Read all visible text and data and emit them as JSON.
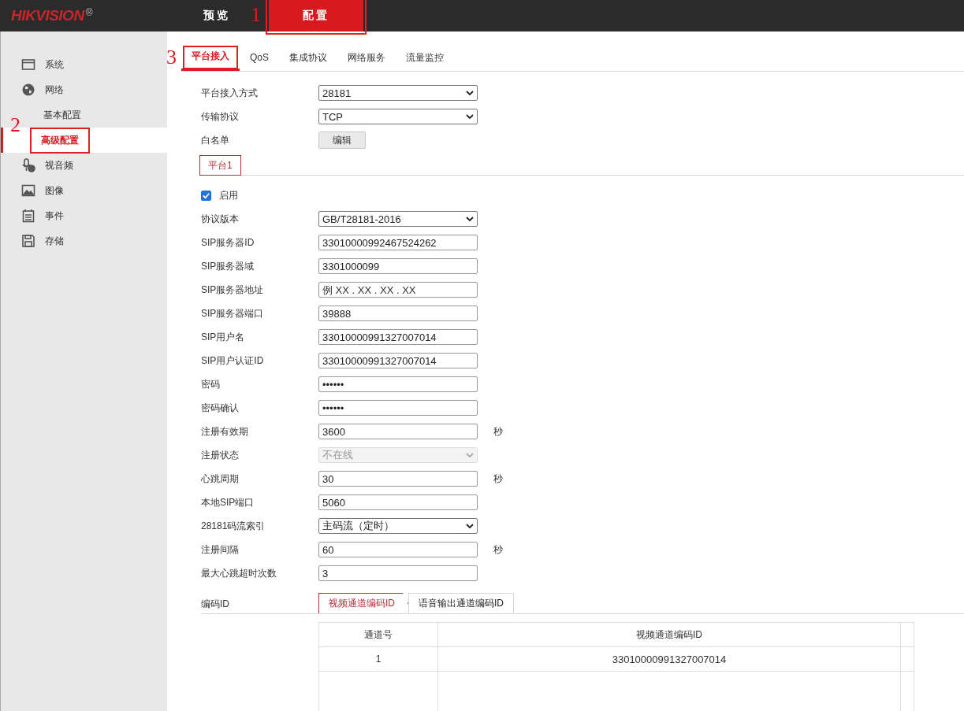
{
  "header": {
    "logo": "HIKVISION",
    "logo_mark": "®",
    "nav": [
      {
        "label": "预览",
        "selected": false
      },
      {
        "label": "配置",
        "selected": true,
        "callout": "1"
      }
    ]
  },
  "sidebar": {
    "items": [
      {
        "label": "系统"
      },
      {
        "label": "网络",
        "children": [
          {
            "label": "基本配置",
            "selected": false
          },
          {
            "label": "高级配置",
            "selected": true,
            "callout": "2"
          }
        ]
      },
      {
        "label": "视音频"
      },
      {
        "label": "图像"
      },
      {
        "label": "事件"
      },
      {
        "label": "存储"
      }
    ]
  },
  "subtabs": [
    {
      "label": "平台接入",
      "selected": true,
      "callout": "3"
    },
    {
      "label": "QoS",
      "selected": false
    },
    {
      "label": "集成协议",
      "selected": false
    },
    {
      "label": "网络服务",
      "selected": false
    },
    {
      "label": "流量监控",
      "selected": false
    }
  ],
  "top_fields": [
    {
      "kind": "select",
      "label": "平台接入方式",
      "value": "28181"
    },
    {
      "kind": "select",
      "label": "传输协议",
      "value": "TCP"
    },
    {
      "kind": "button",
      "label": "白名单",
      "value": "编辑"
    }
  ],
  "platform_tabs": [
    {
      "label": "平台1",
      "selected": true
    }
  ],
  "enable": {
    "label": "启用",
    "checked": true
  },
  "fields": [
    {
      "kind": "select",
      "label": "协议版本",
      "value": "GB/T28181-2016"
    },
    {
      "kind": "input",
      "label": "SIP服务器ID",
      "value": "33010000992467524262"
    },
    {
      "kind": "input",
      "label": "SIP服务器域",
      "value": "3301000099"
    },
    {
      "kind": "input",
      "label": "SIP服务器地址",
      "placeholder": "例 XX . XX . XX . XX"
    },
    {
      "kind": "input",
      "label": "SIP服务器端口",
      "value": "39888"
    },
    {
      "kind": "input",
      "label": "SIP用户名",
      "value": "33010000991327007014"
    },
    {
      "kind": "input",
      "label": "SIP用户认证ID",
      "value": "33010000991327007014"
    },
    {
      "kind": "input",
      "label": "密码",
      "value": "••••••"
    },
    {
      "kind": "input",
      "label": "密码确认",
      "value": "••••••"
    },
    {
      "kind": "input",
      "label": "注册有效期",
      "value": "3600",
      "unit": "秒"
    },
    {
      "kind": "select",
      "label": "注册状态",
      "value": "不在线",
      "disabled": true
    },
    {
      "kind": "input",
      "label": "心跳周期",
      "value": "30",
      "unit": "秒"
    },
    {
      "kind": "input",
      "label": "本地SIP端口",
      "value": "5060"
    },
    {
      "kind": "select",
      "label": "28181码流索引",
      "value": "主码流（定时）"
    },
    {
      "kind": "input",
      "label": "注册间隔",
      "value": "60",
      "unit": "秒"
    },
    {
      "kind": "input",
      "label": "最大心跳超时次数",
      "value": "3"
    }
  ],
  "encoding": {
    "label": "编码ID",
    "tabs": [
      {
        "label": "视频通道编码ID",
        "selected": true
      },
      {
        "label": "语音输出通道编码ID",
        "selected": false
      }
    ],
    "table": {
      "columns": [
        "通道号",
        "视频通道编码ID"
      ],
      "rows": [
        [
          "1",
          "33010000991327007014"
        ]
      ]
    }
  }
}
